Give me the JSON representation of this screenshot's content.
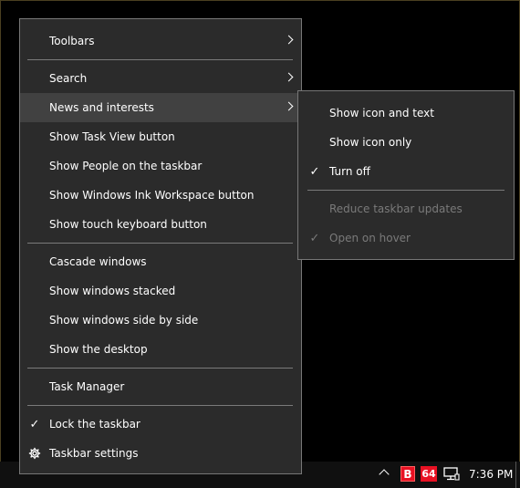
{
  "context_menu": {
    "items": [
      {
        "label": "Toolbars",
        "submenu": true
      },
      {
        "label": "Search",
        "submenu": true
      },
      {
        "label": "News and interests",
        "submenu": true,
        "highlighted": true
      },
      {
        "label": "Show Task View button"
      },
      {
        "label": "Show People on the taskbar"
      },
      {
        "label": "Show Windows Ink Workspace button"
      },
      {
        "label": "Show touch keyboard button"
      },
      {
        "label": "Cascade windows"
      },
      {
        "label": "Show windows stacked"
      },
      {
        "label": "Show windows side by side"
      },
      {
        "label": "Show the desktop"
      },
      {
        "label": "Task Manager"
      },
      {
        "label": "Lock the taskbar",
        "checked": true,
        "check_icon": "checkmark-icon"
      },
      {
        "label": "Taskbar settings",
        "icon": "gear-icon"
      }
    ]
  },
  "news_submenu": {
    "items": [
      {
        "label": "Show icon and text"
      },
      {
        "label": "Show icon only"
      },
      {
        "label": "Turn off",
        "checked": true,
        "check_icon": "checkmark-icon"
      },
      {
        "label": "Reduce taskbar updates",
        "disabled": true
      },
      {
        "label": "Open on hover",
        "disabled": true,
        "checked": true,
        "check_icon": "checkmark-icon"
      }
    ]
  },
  "taskbar": {
    "tray": {
      "overflow_icon": "chevron-up-icon",
      "app_icon_1": {
        "name": "red-b-app-icon",
        "text": "B"
      },
      "app_icon_2": {
        "name": "red-64-app-icon",
        "text": "64"
      },
      "network_icon": "network-icon"
    },
    "clock": "7:36 PM"
  },
  "check_glyph": "✓",
  "colors": {
    "menu_bg": "#2b2b2b",
    "menu_hover": "#414141",
    "disabled_text": "#7a7a7a",
    "tray_accent": "#e81123"
  }
}
